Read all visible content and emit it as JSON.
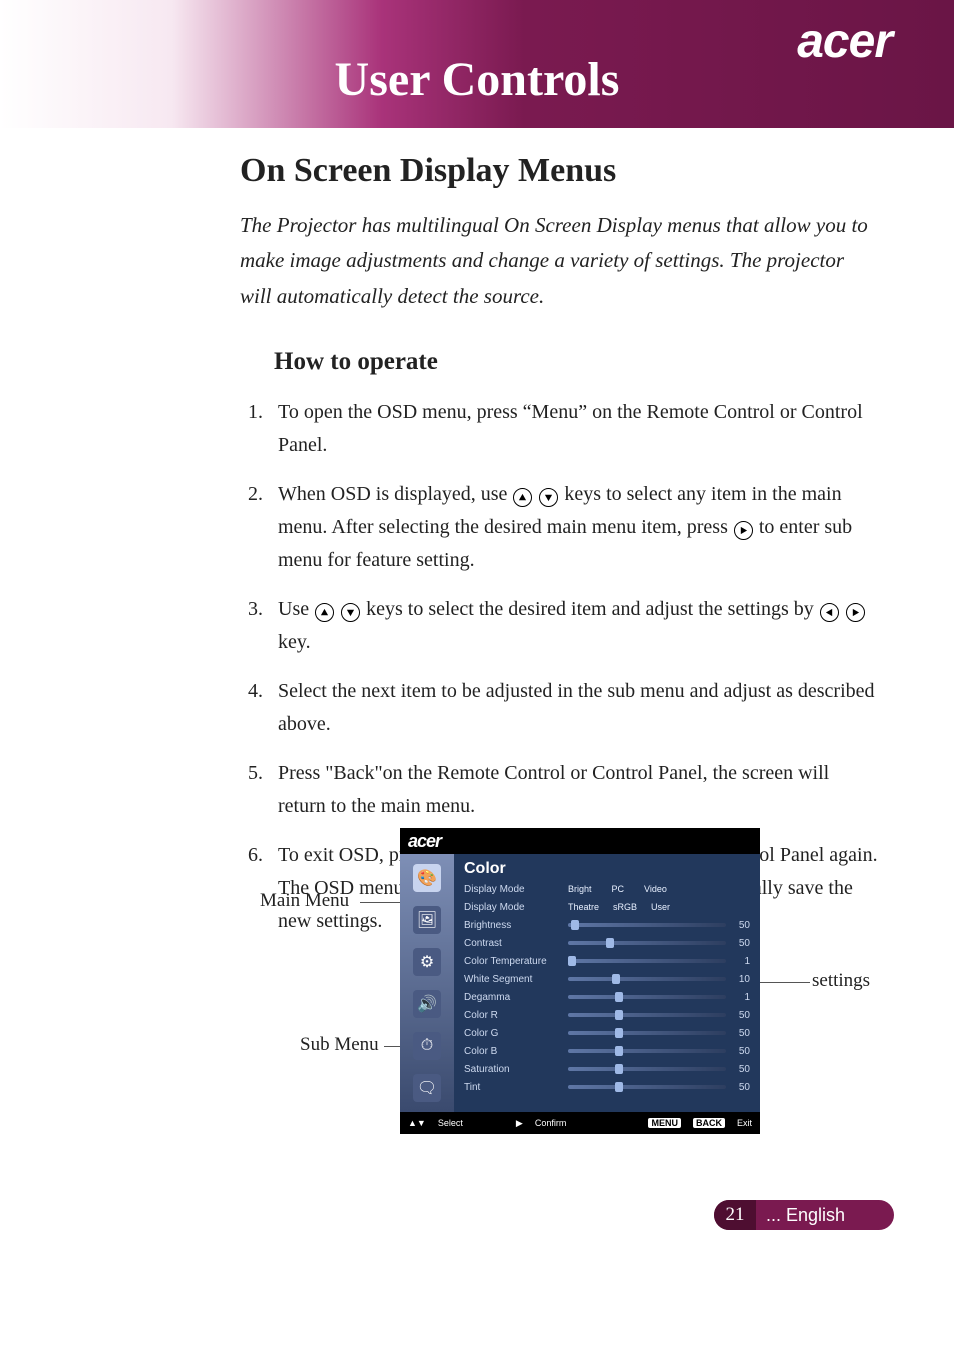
{
  "brand": "acer",
  "header_title": "User Controls",
  "h1": "On Screen Display Menus",
  "intro": "The Projector has multilingual On Screen Display menus that allow you to make image adjustments and change a variety of settings. The projector will automatically detect the source.",
  "h2": "How to operate",
  "steps": {
    "s1": "To open the OSD menu, press “Menu” on the Remote Control or Control Panel.",
    "s2a": "When OSD is displayed, use ",
    "s2b": " keys to select any item in the main menu. After selecting the desired main menu item, press ",
    "s2c": " to enter sub menu for feature setting.",
    "s3a": "Use ",
    "s3b": " keys to select the desired item and adjust the settings by ",
    "s3c": " key.",
    "s4": "Select the next item to be adjusted in the sub menu and adjust as described above.",
    "s5": "Press \"Back\"on the Remote Control or Control Panel, the screen will return to the main menu.",
    "s6": "To exit OSD, press “Menu” on the Remote Control or Control Panel again. The OSD menu will close and the projector will auto-matically save the new settings."
  },
  "callouts": {
    "main": "Main Menu",
    "sub": "Sub Menu",
    "settings": "settings"
  },
  "osd": {
    "brand": "acer",
    "title": "Color",
    "mode_row_label": "Display Mode",
    "modes1": [
      "Bright",
      "PC",
      "Video"
    ],
    "modes2": [
      "Theatre",
      "sRGB",
      "User"
    ],
    "rows": [
      {
        "label": "Brightness",
        "value": 50,
        "pos": 2
      },
      {
        "label": "Contrast",
        "value": 50,
        "pos": 24
      },
      {
        "label": "Color Temperature",
        "value": 1,
        "pos": 0
      },
      {
        "label": "White Segment",
        "value": 10,
        "pos": 28
      },
      {
        "label": "Degamma",
        "value": 1,
        "pos": 30
      },
      {
        "label": "Color R",
        "value": 50,
        "pos": 30
      },
      {
        "label": "Color G",
        "value": 50,
        "pos": 30
      },
      {
        "label": "Color B",
        "value": 50,
        "pos": 30
      },
      {
        "label": "Saturation",
        "value": 50,
        "pos": 30
      },
      {
        "label": "Tint",
        "value": 50,
        "pos": 30
      }
    ],
    "footer": {
      "select": "Select",
      "confirm": "Confirm",
      "menu_chip": "MENU",
      "back_chip": "BACK",
      "exit": "Exit"
    },
    "side_icons": [
      "palette-icon",
      "image-icon",
      "gear-icon",
      "audio-icon",
      "timer-icon",
      "language-icon"
    ]
  },
  "footer": {
    "page_number": "21",
    "lang": "... English"
  }
}
